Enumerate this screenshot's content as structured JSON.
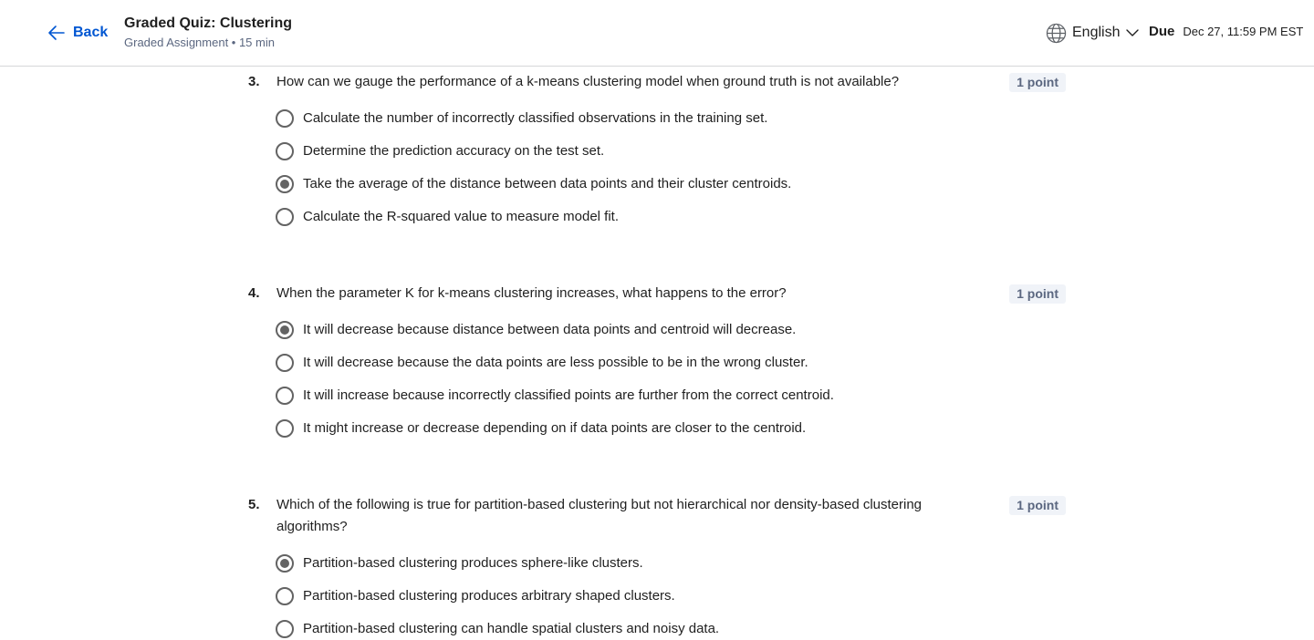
{
  "header": {
    "back_label": "Back",
    "title": "Graded Quiz: Clustering",
    "subtitle": "Graded Assignment • 15 min",
    "language": "English",
    "due_label": "Due",
    "due_date": "Dec 27, 11:59 PM EST"
  },
  "questions": [
    {
      "number": "3.",
      "text": "How can we gauge the performance of a k-means clustering model when ground truth is not available?",
      "points": "1 point",
      "options": [
        {
          "label": "Calculate the number of incorrectly classified observations in the training set.",
          "selected": false
        },
        {
          "label": "Determine the prediction accuracy on the test set.",
          "selected": false
        },
        {
          "label": "Take the average of the distance between data points and their cluster centroids.",
          "selected": true
        },
        {
          "label": "Calculate the R-squared value to measure model fit.",
          "selected": false
        }
      ]
    },
    {
      "number": "4.",
      "text": "When the parameter K for k-means clustering increases, what happens to the error?",
      "points": "1 point",
      "options": [
        {
          "label": "It will decrease because distance between data points and centroid will decrease.",
          "selected": true
        },
        {
          "label": "It will decrease because the data points are less possible to be in the wrong cluster.",
          "selected": false
        },
        {
          "label": "It will increase because incorrectly classified points are further from the correct centroid.",
          "selected": false
        },
        {
          "label": "It might increase or decrease depending on if data points are closer to the centroid.",
          "selected": false
        }
      ]
    },
    {
      "number": "5.",
      "text": "Which of the following is true for partition-based clustering but not hierarchical nor density-based clustering algorithms?",
      "points": "1 point",
      "options": [
        {
          "label": "Partition-based clustering produces sphere-like clusters.",
          "selected": true
        },
        {
          "label": "Partition-based clustering produces arbitrary shaped clusters.",
          "selected": false
        },
        {
          "label": "Partition-based clustering can handle spatial clusters and noisy data.",
          "selected": false
        }
      ]
    }
  ]
}
